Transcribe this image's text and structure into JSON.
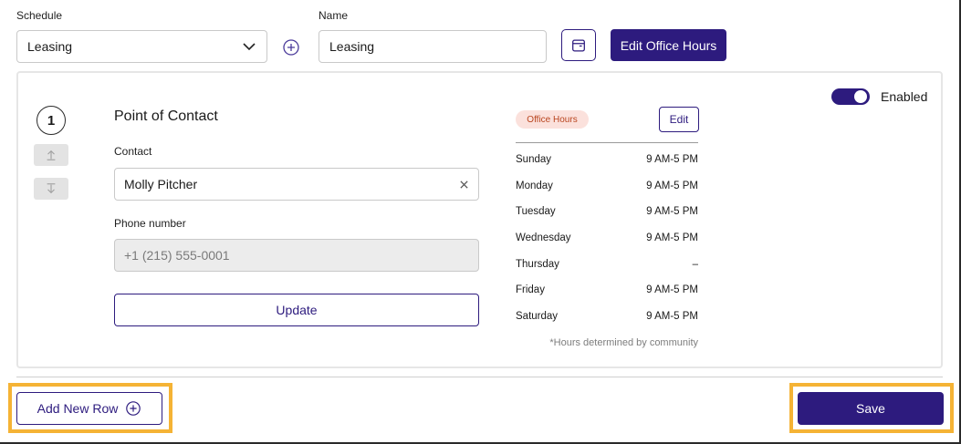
{
  "top": {
    "schedule_label": "Schedule",
    "schedule_value": "Leasing",
    "name_label": "Name",
    "name_value": "Leasing",
    "edit_office_hours_label": "Edit Office Hours"
  },
  "row": {
    "number": "1",
    "title": "Point of Contact",
    "contact_label": "Contact",
    "contact_value": "Molly Pitcher",
    "phone_label": "Phone number",
    "phone_placeholder": "+1 (215) 555-0001",
    "update_label": "Update",
    "office_hours_badge": "Office Hours",
    "edit_label": "Edit",
    "hours": [
      {
        "day": "Sunday",
        "time": "9 AM-5 PM"
      },
      {
        "day": "Monday",
        "time": "9 AM-5 PM"
      },
      {
        "day": "Tuesday",
        "time": "9 AM-5 PM"
      },
      {
        "day": "Wednesday",
        "time": "9 AM-5 PM"
      },
      {
        "day": "Thursday",
        "time": "–"
      },
      {
        "day": "Friday",
        "time": "9 AM-5 PM"
      },
      {
        "day": "Saturday",
        "time": "9 AM-5 PM"
      }
    ],
    "hours_note": "*Hours determined by community",
    "enabled_label": "Enabled",
    "enabled": true
  },
  "footer": {
    "add_row_label": "Add New Row",
    "save_label": "Save"
  },
  "colors": {
    "primary": "#2d1b7e",
    "highlight": "#f5b335",
    "badge_bg": "#fbe1dc",
    "badge_text": "#b9451f"
  }
}
